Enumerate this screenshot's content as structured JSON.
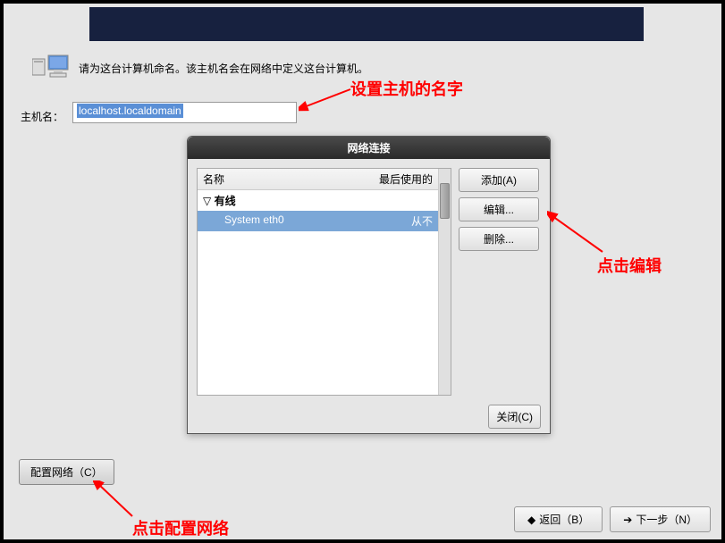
{
  "instruction": "请为这台计算机命名。该主机名会在网络中定义这台计算机。",
  "hostname": {
    "label": "主机名：",
    "value": "localhost.localdomain"
  },
  "dialog": {
    "title": "网络连接",
    "columns": {
      "name": "名称",
      "last_used": "最后使用的"
    },
    "group": "有线",
    "items": [
      {
        "name": "System eth0",
        "last": "从不"
      }
    ],
    "buttons": {
      "add": "添加(A)",
      "edit": "编辑...",
      "delete": "删除...",
      "close": "关闭(C)"
    }
  },
  "config_button": "配置网络（C）",
  "nav": {
    "back": "返回（B）",
    "next": "下一步（N）"
  },
  "annotations": {
    "set_hostname": "设置主机的名字",
    "click_edit": "点击编辑",
    "click_config": "点击配置网络"
  }
}
